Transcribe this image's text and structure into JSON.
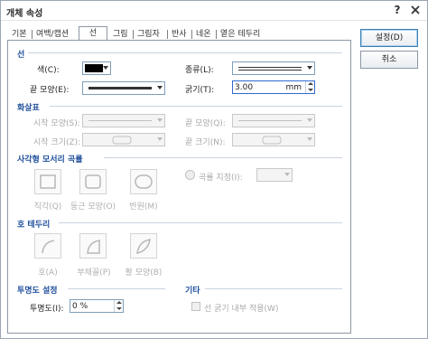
{
  "window": {
    "title": "개체 속성",
    "help": "?",
    "close": "✕"
  },
  "tabs": [
    {
      "label": "기본"
    },
    {
      "label": "여백/캡션"
    },
    {
      "label": "선"
    },
    {
      "label": "그림"
    },
    {
      "label": "그림자"
    },
    {
      "label": "반사"
    },
    {
      "label": "네온"
    },
    {
      "label": "옅은 테두리"
    }
  ],
  "active_tab": "선",
  "buttons": {
    "ok": "설정(D)",
    "cancel": "취소"
  },
  "line": {
    "group": "선",
    "color_label": "색(C):",
    "color_value": "#000000",
    "type_label": "종류(L):",
    "end_label": "끝 모양(E):",
    "width_label": "굵기(T):",
    "width_value": "3.00",
    "width_unit": "mm"
  },
  "arrow": {
    "group": "화살표",
    "start_shape_label": "시작 모양(S):",
    "end_shape_label": "끝 모양(Q):",
    "start_size_label": "시작 크기(Z):",
    "end_size_label": "끝 크기(N):"
  },
  "corner": {
    "group": "사각형 모서리 곡률",
    "options": [
      "직각(Q)",
      "둥근 모양(O)",
      "반원(M)"
    ],
    "custom_label": "곡률 지정(I):"
  },
  "arc": {
    "group": "호 테두리",
    "options": [
      "호(A)",
      "부채꼴(P)",
      "활 모양(B)"
    ]
  },
  "transparency": {
    "group": "투명도 설정",
    "label": "투명도(I):",
    "value": "0 %"
  },
  "other": {
    "group": "기타",
    "checkbox_label": "선 굵기 내부 적용(W)"
  }
}
